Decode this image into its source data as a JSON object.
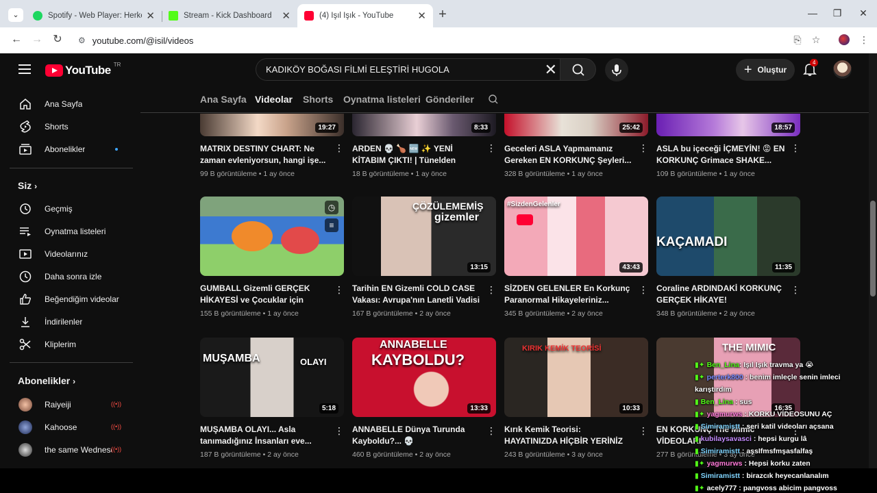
{
  "browser": {
    "tabs": [
      {
        "title": "Spotify - Web Player: Herkes için müzik",
        "favicon_color": "#1ed760"
      },
      {
        "title": "Stream - Kick Dashboard",
        "favicon_color": "#53fc18"
      },
      {
        "title": "(4) Işıl Işık - YouTube",
        "favicon_color": "#ff0033"
      }
    ],
    "url": "youtube.com/@isil/videos"
  },
  "header": {
    "logo_text": "YouTube",
    "country": "TR",
    "search_value": "KADIKÖY BOĞASI FİLMİ ELEŞTİRİ HUGOLA",
    "create_label": "Oluştur",
    "notifications": "4"
  },
  "sidebar": {
    "main": [
      {
        "label": "Ana Sayfa",
        "icon": "home-icon"
      },
      {
        "label": "Shorts",
        "icon": "shorts-icon"
      },
      {
        "label": "Abonelikler",
        "icon": "subscriptions-icon"
      }
    ],
    "you_heading": "Siz",
    "you": [
      {
        "label": "Geçmiş",
        "icon": "history-icon"
      },
      {
        "label": "Oynatma listeleri",
        "icon": "playlists-icon"
      },
      {
        "label": "Videolarınız",
        "icon": "your-videos-icon"
      },
      {
        "label": "Daha sonra izle",
        "icon": "watch-later-icon"
      },
      {
        "label": "Beğendiğim videolar",
        "icon": "liked-icon"
      },
      {
        "label": "İndirilenler",
        "icon": "downloads-icon"
      },
      {
        "label": "Kliplerim",
        "icon": "clips-icon"
      }
    ],
    "subs_heading": "Abonelikler",
    "subs": [
      {
        "label": "Raiyeiji"
      },
      {
        "label": "Kahoose"
      },
      {
        "label": "the same Wednesday"
      }
    ]
  },
  "channel_tabs": [
    "Ana Sayfa",
    "Videolar",
    "Shorts",
    "Oynatma listeleri",
    "Gönderiler"
  ],
  "videos": [
    {
      "title": "MATRIX DESTINY CHART: Ne zaman evleniyorsun, hangi işe...",
      "views": "99 B görüntüleme",
      "age": "1 ay önce",
      "duration": "19:27"
    },
    {
      "title": "ARDEN 💀 🍗 🆕 ✨ YENİ KİTABIM ÇIKTI! | Tünelden Önceki Beyaz Ev...",
      "views": "18 B görüntüleme",
      "age": "1 ay önce",
      "duration": "8:33"
    },
    {
      "title": "Geceleri ASLA Yapmamanız Gereken EN KORKUNÇ Şeyleri...",
      "views": "328 B görüntüleme",
      "age": "1 ay önce",
      "duration": "25:42"
    },
    {
      "title": "ASLA bu içeceği İÇMEYİN! 😡 EN KORKUNÇ Grimace SHAKE...",
      "views": "109 B görüntüleme",
      "age": "1 ay önce",
      "duration": "18:57"
    },
    {
      "title": "GUMBALL Gizemli GERÇEK HİKAYESİ ve Çocuklar için YASAKL...",
      "views": "155 B görüntüleme",
      "age": "1 ay önce",
      "duration": ""
    },
    {
      "title": "Tarihin EN Gizemli COLD CASE Vakası: Avrupa'nın Lanetli Vadisi |...",
      "views": "167 B görüntüleme",
      "age": "2 ay önce",
      "duration": "13:15",
      "overlay": [
        "ÇÖZÜLEMEMİŞ",
        "gizemler"
      ]
    },
    {
      "title": "SİZDEN GELENLER En Korkunç Paranormal Hikayeleriniz...",
      "views": "345 B görüntüleme",
      "age": "2 ay önce",
      "duration": "43:43",
      "overlay": [
        "#SizdenGelenler"
      ]
    },
    {
      "title": "Coraline ARDINDAKİ KORKUNÇ GERÇEK HİKAYE!",
      "views": "348 B görüntüleme",
      "age": "2 ay önce",
      "duration": "11:35",
      "overlay": [
        "KAÇAMADI"
      ]
    },
    {
      "title": "MUŞAMBA OLAYI... Asla tanımadığınız İnsanları eve...",
      "views": "187 B görüntüleme",
      "age": "2 ay önce",
      "duration": "5:18",
      "overlay": [
        "MUŞAMBA",
        "OLAYI"
      ]
    },
    {
      "title": "ANNABELLE Dünya Turunda Kayboldu?... 💀",
      "views": "460 B görüntüleme",
      "age": "2 ay önce",
      "duration": "13:33",
      "overlay": [
        "ANNABELLE",
        "KAYBOLDU?"
      ]
    },
    {
      "title": "Kırık Kemik Teorisi: HAYATINIZDA HİÇBİR YERİNİZ KIRILMADIYSA B...",
      "views": "243 B görüntüleme",
      "age": "3 ay önce",
      "duration": "10:33",
      "overlay": [
        "KIRIK KEMİK TEORİSİ"
      ]
    },
    {
      "title": "EN KORKUNÇ The Mimic VİDEOLARI",
      "views": "277 B görüntüleme",
      "age": "3 ay önce",
      "duration": "16:35",
      "overlay": [
        "THE MIMIC"
      ]
    }
  ],
  "chat": [
    {
      "user": "Ben_Lina",
      "msg": "Işıl Işık travma ya 😭",
      "color": "#53fc18"
    },
    {
      "user": "perterk800",
      "msg": "benim imleçle senin imleci karıştırdım",
      "color": "#7b8cff"
    },
    {
      "user": "Ben_Lina",
      "msg": "sus",
      "color": "#53fc18"
    },
    {
      "user": "yagmurws",
      "msg": "KORKU VİDEOSUNU AÇ",
      "color": "#ff7ad9"
    },
    {
      "user": "Simiramistt",
      "msg": "seri katil videoları açsana",
      "color": "#80d4ff"
    },
    {
      "user": "kubilaysavasci",
      "msg": "hepsi kurgu lâ",
      "color": "#c58cff"
    },
    {
      "user": "Simiramistt",
      "msg": "aşsIfmsfmşasfalfaş",
      "color": "#80d4ff"
    },
    {
      "user": "yagmurws",
      "msg": "Hepsi korku zaten",
      "color": "#ff7ad9"
    },
    {
      "user": "Simiramistt",
      "msg": "birazcık heyecanlanalım",
      "color": "#80d4ff"
    },
    {
      "user": "acely777",
      "msg": "pangvoss abicim pangvoss",
      "color": "#ffffff"
    }
  ]
}
